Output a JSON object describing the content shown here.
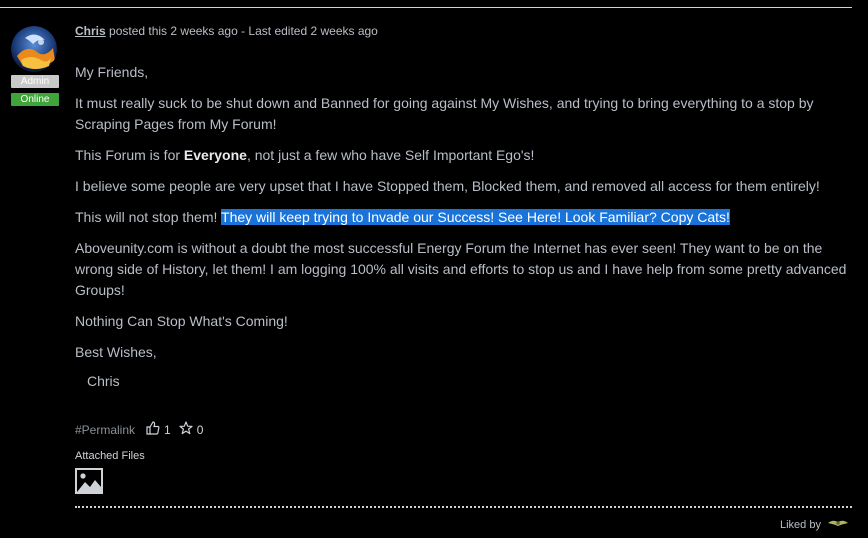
{
  "post": {
    "author": "Chris",
    "meta_text": " posted this 2 weeks ago - Last edited 2 weeks ago",
    "badges": {
      "role": "Admin",
      "status": "Online"
    },
    "paragraphs": {
      "greeting": "My Friends,",
      "p1": "It must really suck to be shut down and Banned for going against My Wishes, and trying to bring everything to a stop by Scraping Pages from My Forum!",
      "p2_before": "This Forum is for ",
      "p2_bold": "Everyone",
      "p2_after": ", not just a few who have Self Important Ego's!",
      "p3": "I believe some people are very upset that I have Stopped them, Blocked them, and removed all access for them entirely!",
      "p4_before": "This will not stop them! ",
      "p4_highlight": "They will keep trying to Invade our Success! See Here! Look Familiar? Copy Cats!",
      "p5": "Aboveunity.com is without a doubt the most successful Energy Forum the Internet has ever seen! They want to be on the wrong side of History, let them! I am logging 100% all visits and efforts to stop us and I have help from some pretty advanced Groups!",
      "p6": "Nothing Can Stop What's Coming!",
      "closing": "Best Wishes,",
      "signature": "Chris"
    },
    "actions": {
      "permalink": "#Permalink",
      "likes": "1",
      "stars": "0",
      "like_icon": "thumbs-up-icon",
      "star_icon": "star-icon"
    },
    "attached_files_label": "Attached Files",
    "attachment_icon": "image-icon",
    "liked_by_label": "Liked by"
  },
  "colors": {
    "background": "#000000",
    "text": "#b9bec7",
    "highlight": "#1a73d9",
    "admin_badge": "#c9c9c9",
    "online_badge": "#3fa53b"
  }
}
